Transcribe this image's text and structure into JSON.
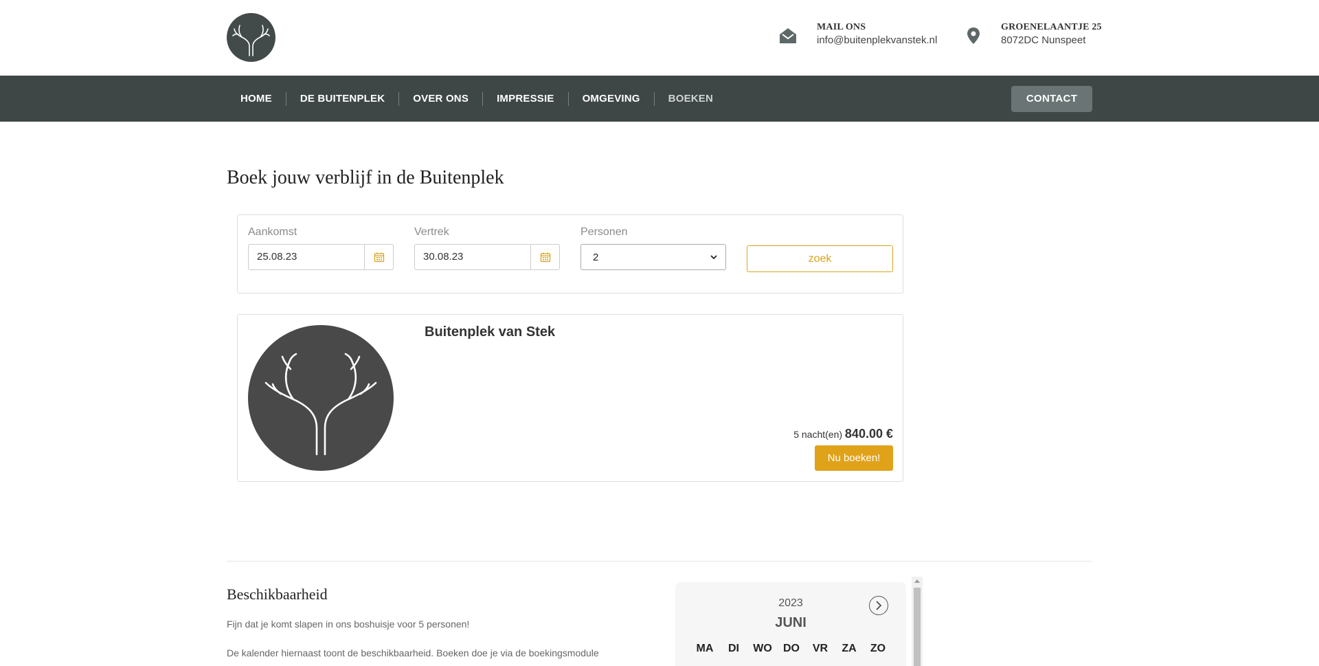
{
  "header": {
    "mail": {
      "label": "MAIL ONS",
      "value": "info@buitenplekvanstek.nl"
    },
    "address": {
      "label": "GROENELAANTJE 25",
      "value": "8072DC Nunspeet"
    }
  },
  "nav": {
    "items": [
      "HOME",
      "DE BUITENPLEK",
      "OVER ONS",
      "IMPRESSIE",
      "OMGEVING",
      "BOEKEN"
    ],
    "contact_label": "CONTACT"
  },
  "page": {
    "title": "Boek jouw verblijf in de Buitenplek"
  },
  "search": {
    "arrival": {
      "label": "Aankomst",
      "value": "25.08.23"
    },
    "departure": {
      "label": "Vertrek",
      "value": "30.08.23"
    },
    "persons": {
      "label": "Personen",
      "value": "2"
    },
    "button_label": "zoek"
  },
  "result": {
    "name": "Buitenplek van Stek",
    "nights": "5 nacht(en)",
    "price": "840.00 €",
    "book_label": "Nu boeken!"
  },
  "availability": {
    "title": "Beschikbaarheid",
    "p1": "Fijn dat je komt slapen in ons boshuisje voor 5 personen!",
    "p2": "De kalender hiernaast toont de beschikbaarheid. Boeken doe je via de boekingsmodule"
  },
  "calendar": {
    "year": "2023",
    "month": "JUNI",
    "weekdays": [
      "MA",
      "DI",
      "WO",
      "DO",
      "VR",
      "ZA",
      "ZO"
    ]
  },
  "colors": {
    "nav_bg": "#3f4646",
    "accent": "#e0a219",
    "logo_bg": "#434a4a"
  },
  "icons": {
    "mail": "envelope-open-icon",
    "address": "map-pin-icon",
    "calendar": "calendar-icon",
    "next": "chevron-right-icon"
  }
}
